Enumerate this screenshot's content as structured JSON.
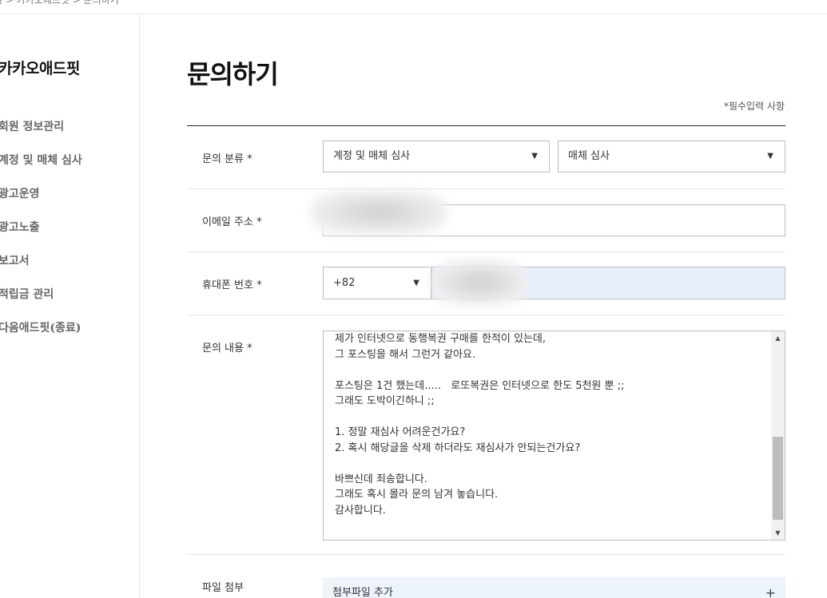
{
  "breadcrumb": "홈 > 카카오애드핏 > 문의하기",
  "sidebar": {
    "title": "카카오애드핏",
    "items": [
      {
        "label": "회원 정보관리"
      },
      {
        "label": "계정 및 매체 심사"
      },
      {
        "label": "광고운영"
      },
      {
        "label": "광고노출"
      },
      {
        "label": "보고서"
      },
      {
        "label": "적립금 관리"
      },
      {
        "label": "다음애드핏(종료)"
      }
    ]
  },
  "page": {
    "title": "문의하기",
    "required_note": "*필수입력 사항"
  },
  "form": {
    "category": {
      "label": "문의 분류 *",
      "primary_value": "계정 및 매체 심사",
      "secondary_value": "매체 심사"
    },
    "email": {
      "label": "이메일 주소 *",
      "value": ""
    },
    "phone": {
      "label": "휴대폰 번호 *",
      "country_code": "+82",
      "value": ""
    },
    "content": {
      "label": "문의 내용 *",
      "text": "제가 인터넷으로 동행복권 구매를 한적이 있는데,\n그 포스팅을 해서 그런거 같아요.\n\n포스팅은 1건 했는데.....   로또복권은 인터넷으로 한도 5천원 뿐 ;;\n그래도 도박이긴하니 ;;\n\n1. 정말 재심사 어려운건가요?\n2. 혹시 해당글을 삭제 하더라도 재심사가 안되는건가요?\n\n바쁘신데 죄송합니다.\n그래도 혹시 몰라 문의 남겨 놓습니다.\n감사합니다."
    },
    "attachment": {
      "label": "파일 첨부",
      "button_label": "첨부파일 추가",
      "add_icon": "plus-icon"
    }
  },
  "icons": {
    "dropdown": "caret-down-icon",
    "scroll_up": "triangle-up-icon",
    "scroll_down": "triangle-down-icon"
  },
  "colors": {
    "tinted_input": "#e9f0fd",
    "attach_bg": "#eef4fc",
    "divider_dark": "#222222"
  }
}
